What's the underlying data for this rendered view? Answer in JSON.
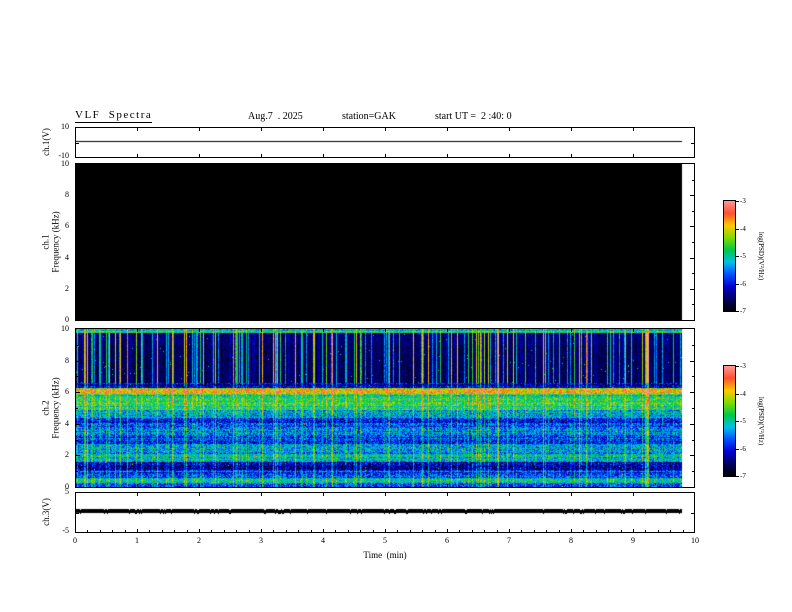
{
  "header": {
    "title": "VLF  Spectra",
    "date": "Aug.7  . 2025",
    "station": "station=GAK",
    "start_ut": "start UT =  2 :40: 0"
  },
  "left_axis": {
    "ch1v_label": "ch.1(V)",
    "spec1_channel": "ch.1",
    "spec2_channel": "ch.2",
    "freq_label": "Frequency  (kHz)",
    "ch3v_label": "ch.3(V)"
  },
  "axes": {
    "ch1v_yticks": [
      "10",
      "-10"
    ],
    "ch3v_yticks": [
      "5",
      "-5"
    ],
    "spec_yticks": [
      "10",
      "8",
      "6",
      "4",
      "2",
      "0"
    ],
    "x_ticks": [
      "0",
      "1",
      "2",
      "3",
      "4",
      "5",
      "6",
      "7",
      "8",
      "9",
      "10"
    ],
    "x_label": "Time  (min)"
  },
  "colorbar": {
    "label": "log(PSD)(V²/Hz)",
    "ticks": [
      "-3",
      "-4",
      "-5",
      "-6",
      "-7"
    ]
  },
  "style": {
    "background": "#ffffff",
    "frame_color": "#000000",
    "colormap_bottom_to_top": [
      "#000000",
      "#000060",
      "#0000d0",
      "#0050ff",
      "#00c0e8",
      "#00c848",
      "#80dc00",
      "#ffc800",
      "#ff5030",
      "#ff9898"
    ]
  },
  "chart_data": [
    {
      "type": "line",
      "name": "ch.1 voltage monitor",
      "ylabel": "ch.1(V)",
      "ylim": [
        -10,
        10
      ],
      "xlim": [
        0,
        10
      ],
      "x_end_min": 9.8,
      "value_v": 1.0,
      "trace": "flat constant trace at about +1 V across full record"
    },
    {
      "type": "heatmap",
      "name": "ch.1 VLF spectrogram",
      "ylabel": "Frequency (kHz)",
      "ylim": [
        0,
        10
      ],
      "xlim": [
        0,
        10
      ],
      "x_end_min": 9.8,
      "zlabel": "log(PSD)(V²/Hz)",
      "zlim": [
        -7,
        -3
      ],
      "content": "uniform minimum power level -7 (rendered solid black) — channel silent"
    },
    {
      "type": "heatmap",
      "name": "ch.2 VLF spectrogram",
      "ylabel": "Frequency (kHz)",
      "ylim": [
        0,
        10
      ],
      "xlim": [
        0,
        10
      ],
      "x_end_min": 9.8,
      "zlabel": "log(PSD)(V²/Hz)",
      "zlim": [
        -7,
        -3
      ],
      "description": "dark background above ~6.6 kHz crossed by dense vertical sferic streaks; strong quasi-continuous emission bands near 6 kHz and 5 kHz; structured blue/cyan horizontal banding below 5 kHz",
      "bands": [
        {
          "f0": 9.75,
          "f1": 10.0,
          "level": 0.5
        },
        {
          "f0": 9.0,
          "f1": 9.75,
          "level": 0.1
        },
        {
          "f0": 6.6,
          "f1": 9.0,
          "level": 0.08
        },
        {
          "f0": 6.25,
          "f1": 6.6,
          "level": 0.18
        },
        {
          "f0": 5.9,
          "f1": 6.25,
          "level": 0.72
        },
        {
          "f0": 5.35,
          "f1": 5.9,
          "level": 0.5
        },
        {
          "f0": 4.85,
          "f1": 5.35,
          "level": 0.55
        },
        {
          "f0": 4.35,
          "f1": 4.85,
          "level": 0.38
        },
        {
          "f0": 3.85,
          "f1": 4.35,
          "level": 0.27
        },
        {
          "f0": 3.3,
          "f1": 3.85,
          "level": 0.33
        },
        {
          "f0": 2.7,
          "f1": 3.3,
          "level": 0.27
        },
        {
          "f0": 2.1,
          "f1": 2.7,
          "level": 0.36
        },
        {
          "f0": 1.55,
          "f1": 2.1,
          "level": 0.44
        },
        {
          "f0": 1.0,
          "f1": 1.55,
          "level": 0.2
        },
        {
          "f0": 0.55,
          "f1": 1.0,
          "level": 0.3
        },
        {
          "f0": 0.25,
          "f1": 0.55,
          "level": 0.46
        },
        {
          "f0": 0.0,
          "f1": 0.25,
          "level": 0.3
        }
      ],
      "streaks": {
        "density": 0.15,
        "strong_density": 0.08,
        "seed": 7
      },
      "noise": 0.28
    },
    {
      "type": "line",
      "name": "ch.3 voltage monitor",
      "ylabel": "ch.3(V)",
      "ylim": [
        -5,
        5
      ],
      "xlim": [
        0,
        10
      ],
      "x_end_min": 9.8,
      "value_v": 0.3,
      "trace": "flat thick noisy trace just above 0 V across full record"
    }
  ]
}
